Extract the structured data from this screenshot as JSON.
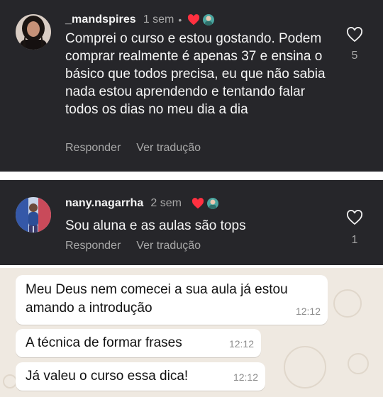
{
  "comments": [
    {
      "username": "_mandspires",
      "time": "1 sem",
      "separator": "•",
      "text": "Comprei o curso e estou gostando. Podem comprar realmente é apenas 37 e ensina o básico que todos precisa, eu que não sabia nada estou aprendendo e tentando falar todos os dias no meu dia a dia",
      "reply_label": "Responder",
      "translate_label": "Ver tradução",
      "like_count": "5"
    },
    {
      "username": "nany.nagarrha",
      "time": "2 sem",
      "text": "Sou aluna e as aulas são tops",
      "reply_label": "Responder",
      "translate_label": "Ver tradução",
      "like_count": "1"
    }
  ],
  "chat": {
    "messages": [
      {
        "text": "Meu Deus nem comecei a sua aula já estou amando a introdução",
        "time": "12:12"
      },
      {
        "text": "A técnica de formar frases",
        "time": "12:12"
      },
      {
        "text": "Já valeu o curso essa dica!",
        "time": "12:12"
      }
    ]
  },
  "colors": {
    "panel_bg": "#26262a",
    "text_primary": "#f5f5f5",
    "text_secondary": "#a8a8a8",
    "heart": "#ff3040",
    "chat_bg": "#efe9e1",
    "bubble_bg": "#ffffff"
  },
  "icons": [
    "heart-outline-icon",
    "heart-filled-icon",
    "avatar"
  ]
}
